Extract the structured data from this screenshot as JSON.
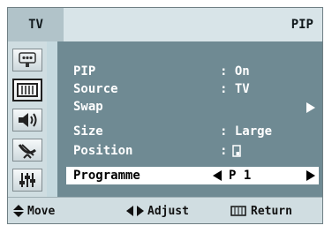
{
  "header": {
    "tab": "TV",
    "title": "PIP"
  },
  "sidebar": {
    "items": [
      {
        "icon": "input-icon"
      },
      {
        "icon": "picture-icon",
        "active": true
      },
      {
        "icon": "sound-icon"
      },
      {
        "icon": "channel-icon"
      },
      {
        "icon": "setup-icon"
      }
    ]
  },
  "menu": {
    "rows": [
      {
        "label": "PIP",
        "value": ": On"
      },
      {
        "label": "Source",
        "value": ": TV"
      },
      {
        "label": "Swap",
        "value": ""
      },
      {
        "label": "Size",
        "value": ": Large"
      },
      {
        "label": "Position",
        "value": ":"
      },
      {
        "label": "Programme",
        "value": "P 1",
        "selected": true
      }
    ]
  },
  "footer": {
    "move": "Move",
    "adjust": "Adjust",
    "return": "Return"
  }
}
